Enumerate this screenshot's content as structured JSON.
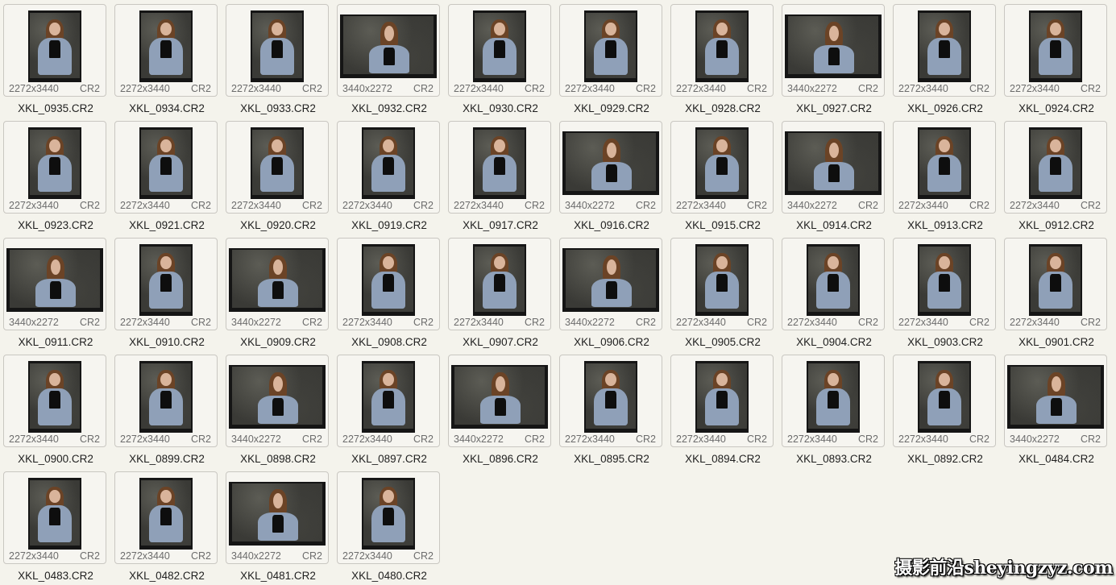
{
  "files": [
    {
      "name": "XKL_0935.CR2",
      "dims": "2272x3440",
      "ext": "CR2"
    },
    {
      "name": "XKL_0934.CR2",
      "dims": "2272x3440",
      "ext": "CR2"
    },
    {
      "name": "XKL_0933.CR2",
      "dims": "2272x3440",
      "ext": "CR2"
    },
    {
      "name": "XKL_0932.CR2",
      "dims": "3440x2272",
      "ext": "CR2"
    },
    {
      "name": "XKL_0930.CR2",
      "dims": "2272x3440",
      "ext": "CR2"
    },
    {
      "name": "XKL_0929.CR2",
      "dims": "2272x3440",
      "ext": "CR2"
    },
    {
      "name": "XKL_0928.CR2",
      "dims": "2272x3440",
      "ext": "CR2"
    },
    {
      "name": "XKL_0927.CR2",
      "dims": "3440x2272",
      "ext": "CR2"
    },
    {
      "name": "XKL_0926.CR2",
      "dims": "2272x3440",
      "ext": "CR2"
    },
    {
      "name": "XKL_0924.CR2",
      "dims": "2272x3440",
      "ext": "CR2"
    },
    {
      "name": "XKL_0923.CR2",
      "dims": "2272x3440",
      "ext": "CR2"
    },
    {
      "name": "XKL_0921.CR2",
      "dims": "2272x3440",
      "ext": "CR2"
    },
    {
      "name": "XKL_0920.CR2",
      "dims": "2272x3440",
      "ext": "CR2"
    },
    {
      "name": "XKL_0919.CR2",
      "dims": "2272x3440",
      "ext": "CR2"
    },
    {
      "name": "XKL_0917.CR2",
      "dims": "2272x3440",
      "ext": "CR2"
    },
    {
      "name": "XKL_0916.CR2",
      "dims": "3440x2272",
      "ext": "CR2"
    },
    {
      "name": "XKL_0915.CR2",
      "dims": "2272x3440",
      "ext": "CR2"
    },
    {
      "name": "XKL_0914.CR2",
      "dims": "3440x2272",
      "ext": "CR2"
    },
    {
      "name": "XKL_0913.CR2",
      "dims": "2272x3440",
      "ext": "CR2"
    },
    {
      "name": "XKL_0912.CR2",
      "dims": "2272x3440",
      "ext": "CR2"
    },
    {
      "name": "XKL_0911.CR2",
      "dims": "3440x2272",
      "ext": "CR2"
    },
    {
      "name": "XKL_0910.CR2",
      "dims": "2272x3440",
      "ext": "CR2"
    },
    {
      "name": "XKL_0909.CR2",
      "dims": "3440x2272",
      "ext": "CR2"
    },
    {
      "name": "XKL_0908.CR2",
      "dims": "2272x3440",
      "ext": "CR2"
    },
    {
      "name": "XKL_0907.CR2",
      "dims": "2272x3440",
      "ext": "CR2"
    },
    {
      "name": "XKL_0906.CR2",
      "dims": "3440x2272",
      "ext": "CR2"
    },
    {
      "name": "XKL_0905.CR2",
      "dims": "2272x3440",
      "ext": "CR2"
    },
    {
      "name": "XKL_0904.CR2",
      "dims": "2272x3440",
      "ext": "CR2"
    },
    {
      "name": "XKL_0903.CR2",
      "dims": "2272x3440",
      "ext": "CR2"
    },
    {
      "name": "XKL_0901.CR2",
      "dims": "2272x3440",
      "ext": "CR2"
    },
    {
      "name": "XKL_0900.CR2",
      "dims": "2272x3440",
      "ext": "CR2"
    },
    {
      "name": "XKL_0899.CR2",
      "dims": "2272x3440",
      "ext": "CR2"
    },
    {
      "name": "XKL_0898.CR2",
      "dims": "3440x2272",
      "ext": "CR2"
    },
    {
      "name": "XKL_0897.CR2",
      "dims": "2272x3440",
      "ext": "CR2"
    },
    {
      "name": "XKL_0896.CR2",
      "dims": "3440x2272",
      "ext": "CR2"
    },
    {
      "name": "XKL_0895.CR2",
      "dims": "2272x3440",
      "ext": "CR2"
    },
    {
      "name": "XKL_0894.CR2",
      "dims": "2272x3440",
      "ext": "CR2"
    },
    {
      "name": "XKL_0893.CR2",
      "dims": "2272x3440",
      "ext": "CR2"
    },
    {
      "name": "XKL_0892.CR2",
      "dims": "2272x3440",
      "ext": "CR2"
    },
    {
      "name": "XKL_0484.CR2",
      "dims": "3440x2272",
      "ext": "CR2"
    },
    {
      "name": "XKL_0483.CR2",
      "dims": "2272x3440",
      "ext": "CR2"
    },
    {
      "name": "XKL_0482.CR2",
      "dims": "2272x3440",
      "ext": "CR2"
    },
    {
      "name": "XKL_0481.CR2",
      "dims": "3440x2272",
      "ext": "CR2"
    },
    {
      "name": "XKL_0480.CR2",
      "dims": "2272x3440",
      "ext": "CR2"
    }
  ],
  "watermark": "摄影前沿sheyingzyz.com"
}
